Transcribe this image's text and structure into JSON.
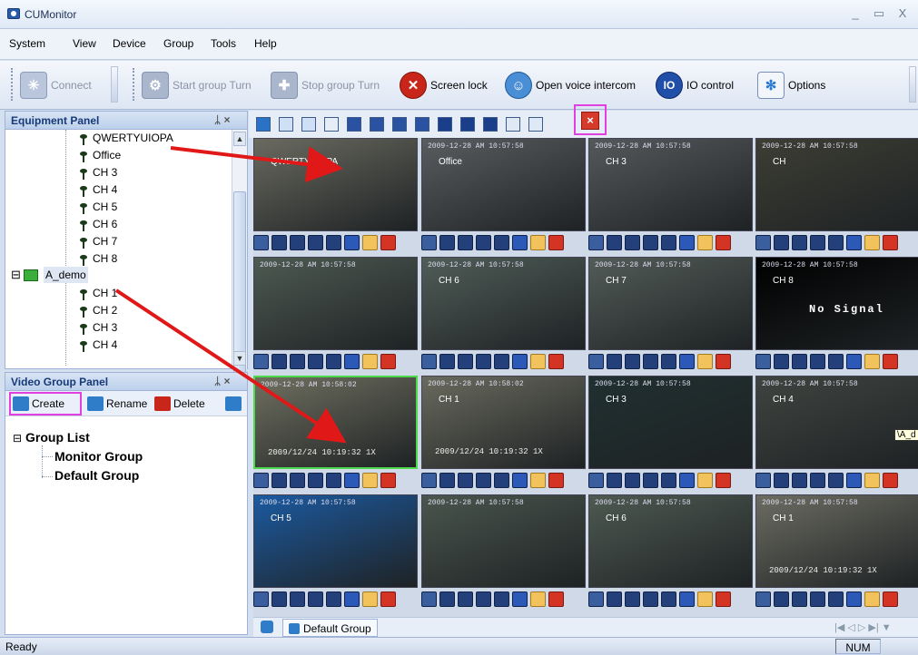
{
  "window": {
    "title": "CUMonitor",
    "min": "_",
    "max": "▭",
    "close": "X"
  },
  "menu": [
    "System",
    "View",
    "Device",
    "Group",
    "Tools",
    "Help"
  ],
  "toolbar": {
    "connect": "Connect",
    "start_group_turn": "Start group Turn",
    "stop_group_turn": "Stop group Turn",
    "screen_lock": "Screen lock",
    "open_voice_intercom": "Open voice intercom",
    "io_control": "IO control",
    "options": "Options"
  },
  "equipment_panel": {
    "title": "Equipment Panel",
    "pin": "ᛦ ×",
    "items": [
      "QWERTYUIOPA",
      "Office",
      "CH 3",
      "CH 4",
      "CH 5",
      "CH 6",
      "CH 7",
      "CH 8"
    ],
    "group": {
      "expander": "⊟",
      "name": "A_demo",
      "items": [
        "CH 1",
        "CH 2",
        "CH 3",
        "CH 4"
      ]
    }
  },
  "video_group_panel": {
    "title": "Video Group Panel",
    "pin": "ᛦ ×",
    "create": "Create",
    "rename": "Rename",
    "delete": "Delete",
    "root": "Group List",
    "root_expander": "⊟",
    "groups": [
      "Monitor Group",
      "Default Group"
    ]
  },
  "layout_close": "×",
  "tiles": [
    {
      "osd": "",
      "ch": "QWERTYUIOPA",
      "bg": "#6a6a60"
    },
    {
      "osd": "2009-12-28 AM 10:57:58",
      "ch": "Office",
      "bg": "#595d60"
    },
    {
      "osd": "2009-12-28 AM 10:57:58",
      "ch": "CH 3",
      "bg": "#55595c"
    },
    {
      "osd": "2009-12-28 AM 10:57:58",
      "ch": "CH",
      "bg": "#3d3e34"
    },
    {
      "osd": "2009-12-28 AM 10:57:58",
      "ch": "",
      "bg": "#4e5a52"
    },
    {
      "osd": "2009-12-28 AM 10:57:58",
      "ch": "CH 6",
      "bg": "#505d58"
    },
    {
      "osd": "2009-12-28 AM 10:57:58",
      "ch": "CH 7",
      "bg": "#525c58"
    },
    {
      "osd": "2009-12-28 AM 10:57:58",
      "ch": "CH 8",
      "bg": "#000000",
      "nosignal": "No Signal"
    },
    {
      "osd": "2009-12-28 AM 10:58:02",
      "ch": "",
      "bg": "#707060",
      "stamp": "2009/12/24 10:19:32 1X"
    },
    {
      "osd": "2009-12-28 AM 10:58:02",
      "ch": "CH 1",
      "bg": "#6a6a5e",
      "stamp": "2009/12/24 10:19:32 1X"
    },
    {
      "osd": "2009-12-28 AM 10:57:58",
      "ch": "CH 3",
      "bg": "#203030"
    },
    {
      "osd": "2009-12-28 AM 10:57:58",
      "ch": "CH 4",
      "bg": "#404440",
      "tag": "\\A_d"
    },
    {
      "osd": "2009-12-28 AM 10:57:58",
      "ch": "CH 5",
      "bg": "#1c5aa0"
    },
    {
      "osd": "2009-12-28 AM 10:57:58",
      "ch": "",
      "bg": "#4a564e"
    },
    {
      "osd": "2009-12-28 AM 10:57:58",
      "ch": "CH 6",
      "bg": "#4e5a52"
    },
    {
      "osd": "2009-12-28 AM 10:57:58",
      "ch": "CH 1",
      "bg": "#6c6c62",
      "stamp": "2009/12/24 10:19:32 1X"
    }
  ],
  "bottom_tab": {
    "label": "Default Group",
    "nav": "|◀  ◁  ▷  ▶|  ▼"
  },
  "status": {
    "text": "Ready",
    "num": "NUM"
  }
}
